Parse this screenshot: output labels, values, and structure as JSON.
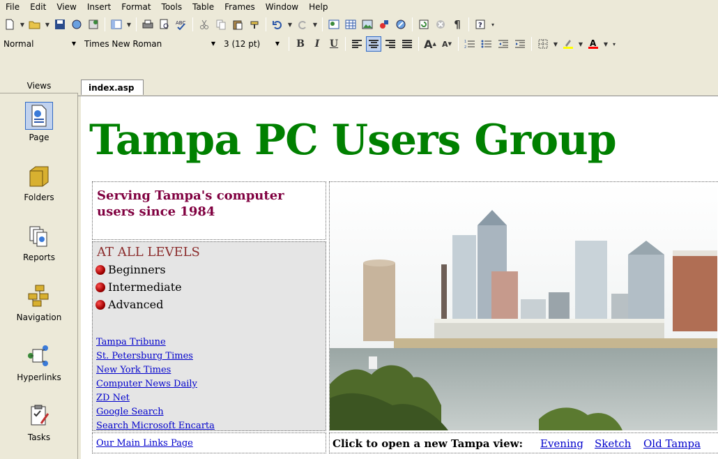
{
  "menu": [
    "File",
    "Edit",
    "View",
    "Insert",
    "Format",
    "Tools",
    "Table",
    "Frames",
    "Window",
    "Help"
  ],
  "menu_underline": [
    "F",
    "E",
    "V",
    "I",
    "o",
    "T",
    "a",
    "r",
    "W",
    "H"
  ],
  "formatting": {
    "style": "Normal",
    "font": "Times New Roman",
    "size": "3  (12 pt)",
    "bold_label": "B",
    "italic_label": "I",
    "underline_label": "U"
  },
  "views": {
    "header": "Views",
    "items": [
      {
        "label": "Page",
        "icon": "page-view-icon"
      },
      {
        "label": "Folders",
        "icon": "folder-icon"
      },
      {
        "label": "Reports",
        "icon": "reports-icon"
      },
      {
        "label": "Navigation",
        "icon": "navigation-icon"
      },
      {
        "label": "Hyperlinks",
        "icon": "hyperlinks-icon"
      },
      {
        "label": "Tasks",
        "icon": "tasks-icon"
      }
    ]
  },
  "document": {
    "tab": "index.asp",
    "title": "Tampa PC Users Group",
    "serving_line1": "Serving Tampa's computer",
    "serving_line2": "users since 1984",
    "levels_title": "AT ALL LEVELS",
    "levels": [
      "Beginners",
      "Intermediate",
      "Advanced"
    ],
    "links": [
      "Tampa Tribune",
      "St. Petersburg Times",
      "New York Times",
      "Computer News Daily",
      "ZD Net",
      "Google Search",
      "Search Microsoft Encarta"
    ],
    "main_links": "Our Main Links Page",
    "click_label": "Click to open a new Tampa view:",
    "view_links": [
      "Evening",
      "Sketch",
      "Old Tampa"
    ]
  },
  "colors": {
    "title": "#008000",
    "serving": "#800040",
    "levels": "#8b2c2c",
    "link": "#0000cc"
  }
}
